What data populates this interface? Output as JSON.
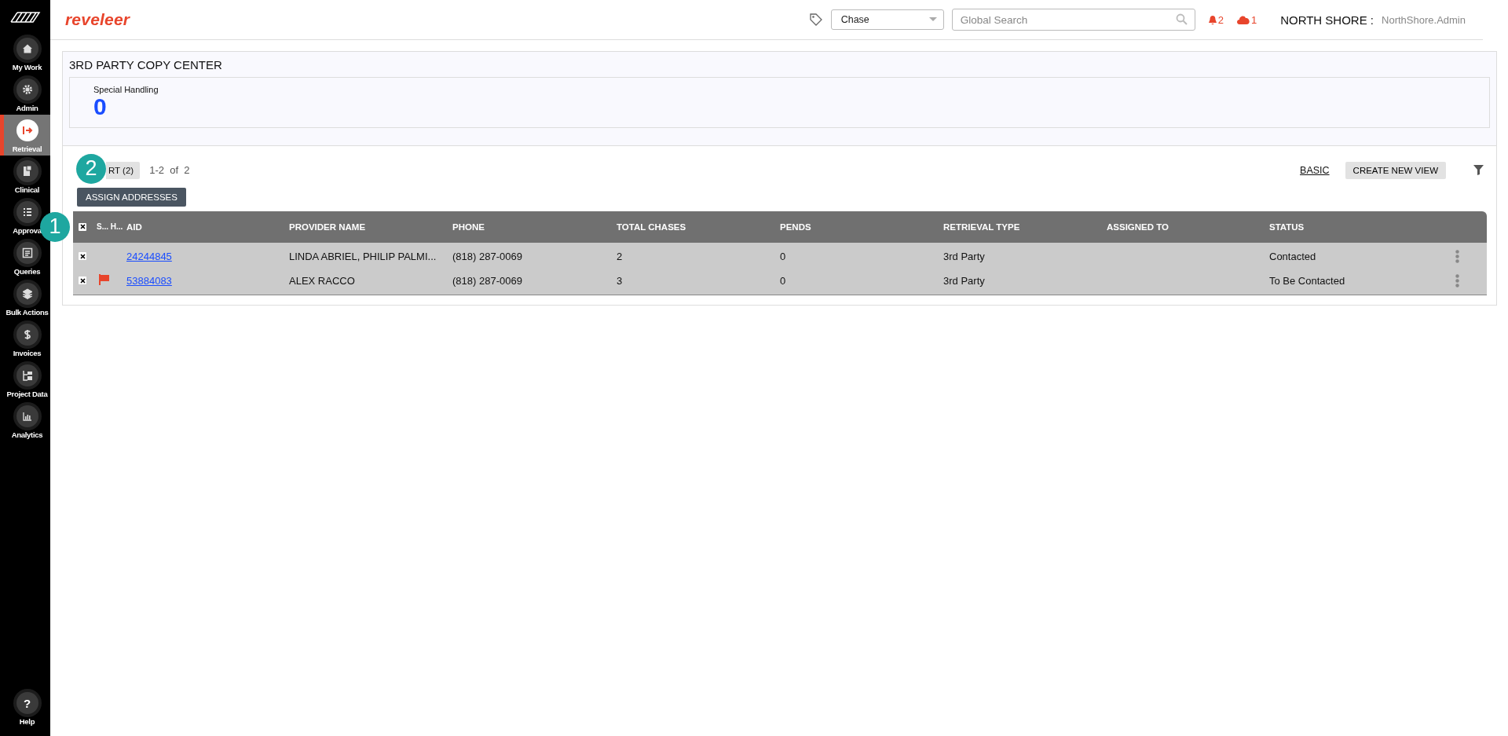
{
  "sidebar": {
    "items": [
      {
        "label": "My Work",
        "selected": false
      },
      {
        "label": "Admin",
        "selected": false
      },
      {
        "label": "Retrieval",
        "selected": true
      },
      {
        "label": "Clinical",
        "selected": false
      },
      {
        "label": "Approva",
        "selected": false
      },
      {
        "label": "Queries",
        "selected": false
      },
      {
        "label": "Bulk Actions",
        "selected": false
      },
      {
        "label": "Invoices",
        "selected": false
      },
      {
        "label": "Project Data",
        "selected": false
      },
      {
        "label": "Analytics",
        "selected": false
      }
    ],
    "help": {
      "label": "Help",
      "icon_text": "?"
    }
  },
  "header": {
    "logo": "reveleer",
    "project_select": {
      "value": "Chase"
    },
    "search": {
      "placeholder": "Global Search"
    },
    "alerts": "2",
    "cloud_count": "1",
    "org": "NORTH SHORE :",
    "user": "NorthShore.Admin"
  },
  "page": {
    "title": "3RD PARTY COPY CENTER",
    "stat": {
      "label": "Special Handling",
      "value": "0"
    }
  },
  "toolbar": {
    "sort_button": "RT (2)",
    "range": "1-2  of  2",
    "basic_link": "BASIC",
    "create_view_button": "CREATE NEW VIEW",
    "assign_button": "ASSIGN ADDRESSES"
  },
  "tour_markers": [
    {
      "number": "1"
    },
    {
      "number": "2"
    }
  ],
  "table": {
    "select_all_checked": true,
    "columns": [
      "S... H...",
      "AID",
      "PROVIDER NAME",
      "PHONE",
      "TOTAL CHASES",
      "PENDS",
      "RETRIEVAL TYPE",
      "ASSIGNED TO",
      "STATUS"
    ],
    "rows": [
      {
        "checked": true,
        "special_handling": false,
        "aid": "24244845",
        "provider": "LINDA ABRIEL, PHILIP PALMI...",
        "phone": "(818) 287-0069",
        "total_chases": "2",
        "pends": "0",
        "retrieval_type": "3rd Party",
        "status": "Contacted"
      },
      {
        "checked": true,
        "special_handling": true,
        "aid": "53884083",
        "provider": "ALEX RACCO",
        "phone": "(818) 287-0069",
        "total_chases": "3",
        "pends": "0",
        "retrieval_type": "3rd Party",
        "status": "To Be Contacted"
      }
    ]
  }
}
